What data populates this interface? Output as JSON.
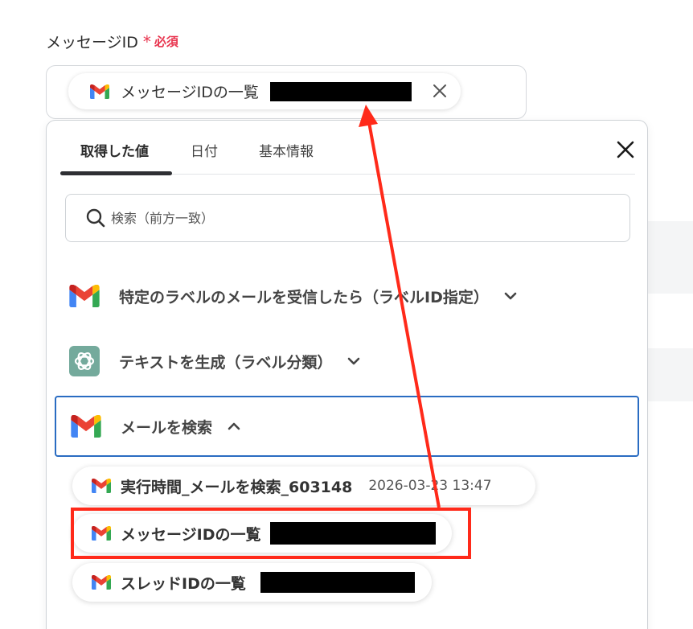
{
  "field": {
    "label": "メッセージID",
    "asterisk": "*",
    "required": "必須",
    "selected_chip": "メッセージIDの一覧"
  },
  "tabs": [
    {
      "label": "取得した値",
      "active": true
    },
    {
      "label": "日付",
      "active": false
    },
    {
      "label": "基本情報",
      "active": false
    }
  ],
  "search": {
    "placeholder": "検索（前方一致）"
  },
  "sections": [
    {
      "label": "特定のラベルのメールを受信したら（ラベルID指定）",
      "icon": "gmail-icon",
      "state": "collapsed"
    },
    {
      "label": "テキストを生成（ラベル分類）",
      "icon": "chatgpt-icon",
      "state": "collapsed"
    },
    {
      "label": "メールを検索",
      "icon": "gmail-icon",
      "state": "expanded"
    }
  ],
  "items": [
    {
      "label": "実行時間_メールを検索_603148",
      "value": "2026-03-23 13:47"
    },
    {
      "label": "メッセージIDの一覧",
      "value": ""
    },
    {
      "label": "スレッドIDの一覧",
      "value": ""
    }
  ],
  "colors": {
    "accent_required": "#e8344e",
    "annotation_red": "#ff2a1a",
    "expanded_border": "#2a6cc2"
  }
}
